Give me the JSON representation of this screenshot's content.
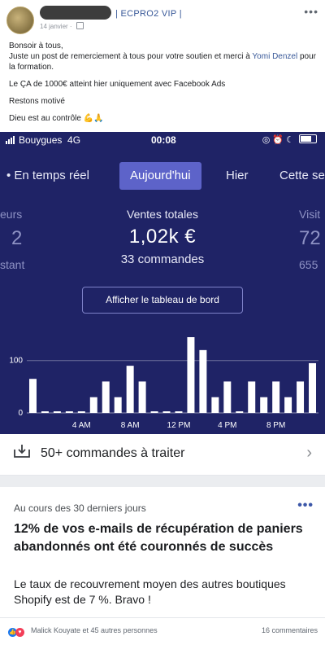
{
  "post": {
    "group_name": "| ECPRO2 VIP |",
    "date": "14 janvier",
    "text": {
      "line1": "Bonsoir à tous,",
      "line2_pre": "Juste un post de remerciement à tous pour votre soutien et merci à ",
      "line2_link": "Yomi Denzel",
      "line2_post": " pour la formation.",
      "line3": "Le ÇA de 1000€ atteint hier uniquement avec Facebook Ads",
      "line4": "Restons motivé",
      "line5": "Dieu est au contrôle 💪🙏"
    }
  },
  "phone": {
    "carrier": "Bouygues",
    "network": "4G",
    "time": "00:08"
  },
  "tabs": [
    {
      "label": "• En temps réel"
    },
    {
      "label": "Aujourd'hui"
    },
    {
      "label": "Hier"
    },
    {
      "label": "Cette se"
    }
  ],
  "metrics": {
    "left": {
      "title": "eurs",
      "value": "2",
      "sub": "stant"
    },
    "center": {
      "title": "Ventes totales",
      "value": "1,02k €",
      "sub": "33 commandes"
    },
    "right": {
      "title": "Visit",
      "value": "72",
      "sub": "655"
    }
  },
  "dashboard_button": "Afficher le tableau de bord",
  "chart_data": {
    "type": "bar",
    "ytick_labels": [
      "0",
      "100"
    ],
    "ylim": [
      0,
      140
    ],
    "xtick_labels": [
      "4 AM",
      "8 AM",
      "12 PM",
      "4 PM",
      "8 PM"
    ],
    "hours": [
      0,
      1,
      2,
      3,
      4,
      5,
      6,
      7,
      8,
      9,
      10,
      11,
      12,
      13,
      14,
      15,
      16,
      17,
      18,
      19,
      20,
      21,
      22,
      23
    ],
    "values": [
      65,
      3,
      3,
      3,
      3,
      30,
      60,
      30,
      90,
      60,
      3,
      3,
      3,
      150,
      120,
      30,
      60,
      3,
      60,
      30,
      60,
      30,
      60,
      95
    ],
    "xtick_hours": [
      4,
      8,
      12,
      16,
      20
    ]
  },
  "orders": {
    "label": "50+ commandes à traiter"
  },
  "card": {
    "subtitle": "Au cours des 30 derniers jours",
    "title": "12% de vos e-mails de récupération de paniers abandonnés ont été couronnés de succès",
    "body": "Le taux de recouvrement moyen des autres boutiques Shopify est de 7 %. Bravo !"
  },
  "reactions": {
    "text": "Malick Kouyate et 45 autres personnes",
    "comments": "16 commentaires"
  },
  "colors": {
    "shopify_bg": "#1f2366",
    "active_tab": "#5d63c9",
    "link": "#385898"
  }
}
